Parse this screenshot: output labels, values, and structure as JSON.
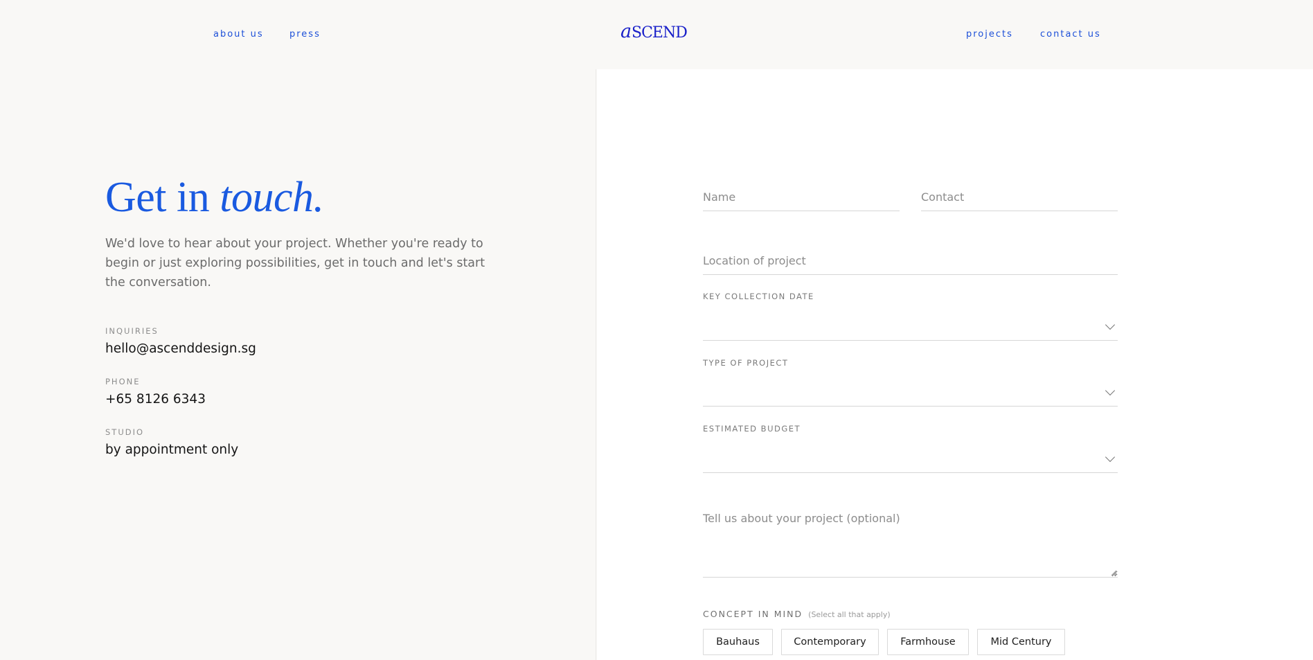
{
  "nav": {
    "left": [
      "about us",
      "press"
    ],
    "right": [
      "projects",
      "contact us"
    ],
    "logo": "ascend"
  },
  "hero": {
    "heading_plain": "Get in",
    "heading_italic": "touch.",
    "intro": "We'd love to hear about your project. Whether you're ready to begin or just exploring possibilities, get in touch and let's start the conversation."
  },
  "info": [
    {
      "label": "INQUIRIES",
      "value": "hello@ascenddesign.sg"
    },
    {
      "label": "PHONE",
      "value": "+65 8126 6343"
    },
    {
      "label": "STUDIO",
      "value": "by appointment only"
    }
  ],
  "form": {
    "name_placeholder": "Name",
    "contact_placeholder": "Contact",
    "location_placeholder": "Location of project",
    "key_collection_label": "KEY COLLECTION DATE",
    "project_type_label": "TYPE OF PROJECT",
    "budget_label": "ESTIMATED BUDGET",
    "message_placeholder": "Tell us about your project (optional)",
    "concept_label": "CONCEPT IN MIND",
    "concept_hint": "(Select all that apply)",
    "concepts": [
      "Bauhaus",
      "Contemporary",
      "Farmhouse",
      "Mid Century"
    ]
  },
  "colors": {
    "accent": "#1a5ae0",
    "nav": "#1c4fd8",
    "logo": "#1a21c9"
  }
}
